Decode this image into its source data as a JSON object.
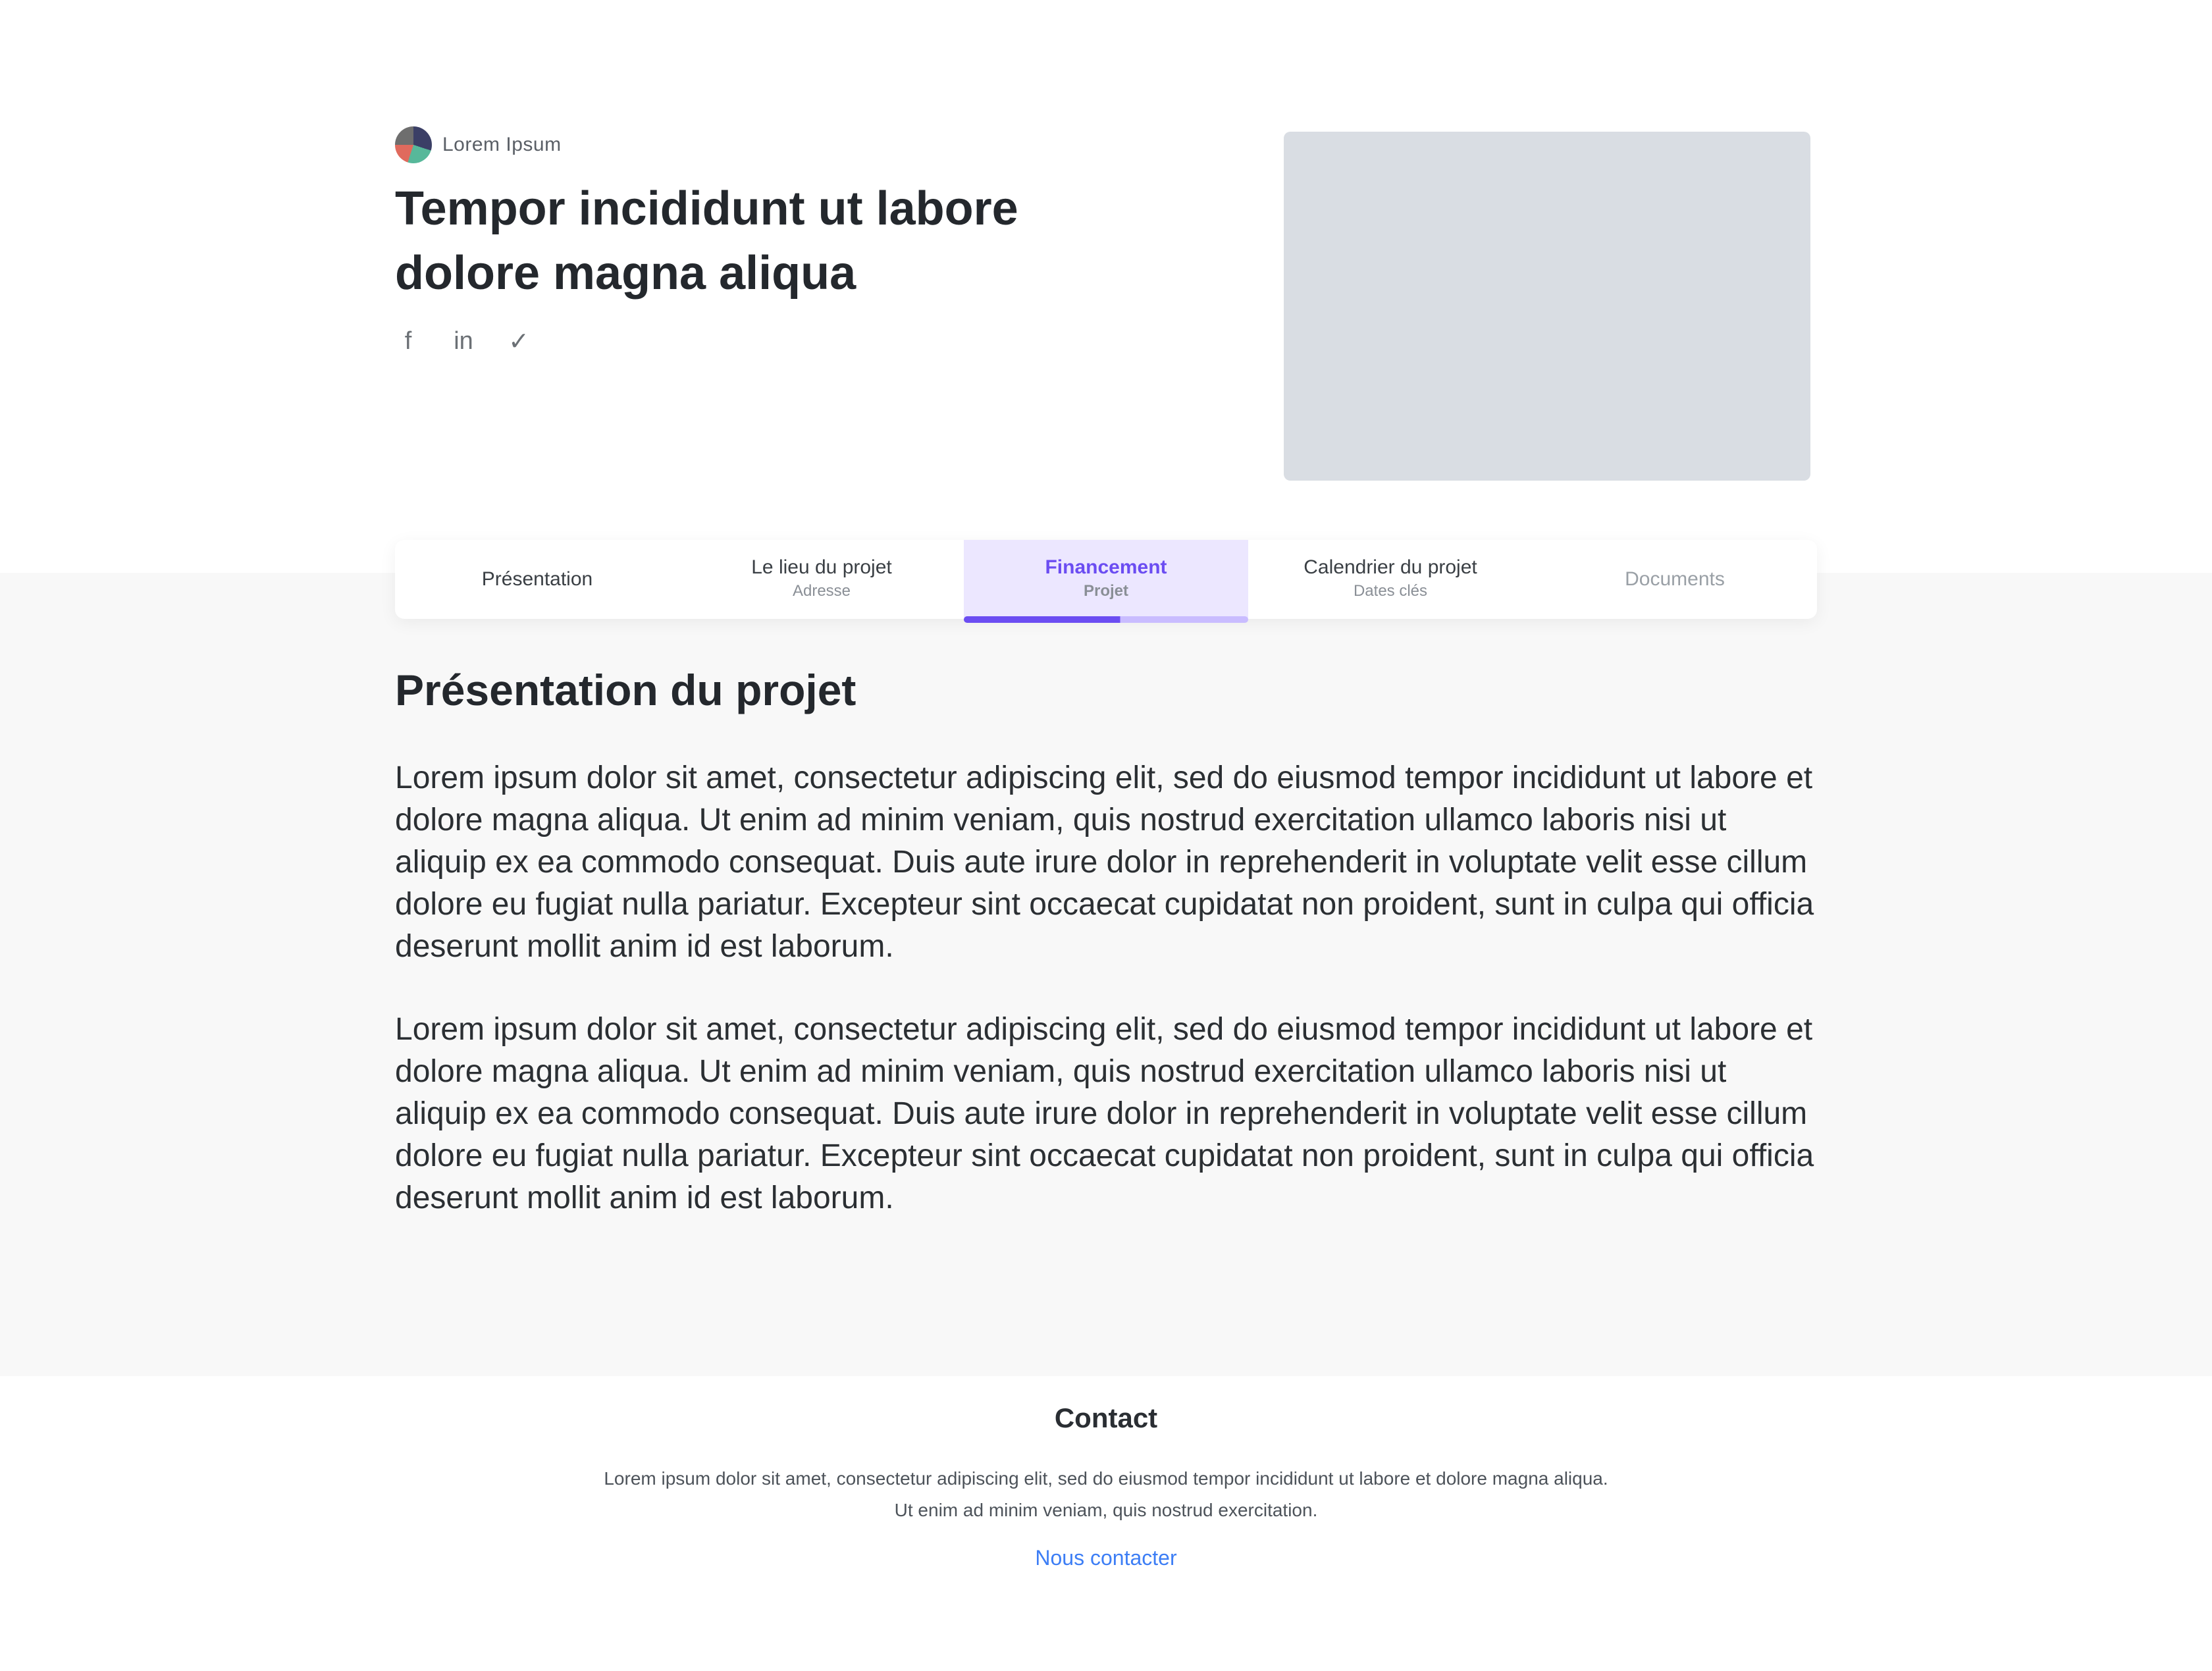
{
  "header": {
    "brand_name": "Lorem Ipsum",
    "title": "Tempor incididunt ut labore dolore magna aliqua",
    "social_icons": [
      "facebook-icon",
      "linkedin-icon",
      "twitter-icon"
    ]
  },
  "tabs": [
    {
      "label": "Présentation",
      "sub": ""
    },
    {
      "label": "Le lieu du projet",
      "sub": "Adresse"
    },
    {
      "label": "Financement",
      "sub": "Projet"
    },
    {
      "label": "Calendrier du projet",
      "sub": "Dates clés"
    },
    {
      "label": "Documents",
      "sub": ""
    }
  ],
  "content": {
    "section_title": "Présentation du projet",
    "paragraphs": [
      "Lorem ipsum dolor sit amet, consectetur adipiscing elit, sed do eiusmod tempor incididunt ut labore et dolore magna aliqua. Ut enim ad minim veniam, quis nostrud exercitation ullamco laboris nisi ut aliquip ex ea commodo consequat. Duis aute irure dolor in reprehenderit in voluptate velit esse cillum dolore eu fugiat nulla pariatur. Excepteur sint occaecat cupidatat non proident, sunt in culpa qui officia deserunt mollit anim id est laborum.",
      "Lorem ipsum dolor sit amet, consectetur adipiscing elit, sed do eiusmod tempor incididunt ut labore et dolore magna aliqua. Ut enim ad minim veniam, quis nostrud exercitation ullamco laboris nisi ut aliquip ex ea commodo consequat. Duis aute irure dolor in reprehenderit in voluptate velit esse cillum dolore eu fugiat nulla pariatur. Excepteur sint occaecat cupidatat non proident, sunt in culpa qui officia deserunt mollit anim id est laborum."
    ]
  },
  "footer": {
    "title": "Contact",
    "text": "Lorem ipsum dolor sit amet, consectetur adipiscing elit, sed do eiusmod tempor incididunt ut labore et dolore magna aliqua. Ut enim ad minim veniam, quis nostrud exercitation.",
    "link": "Nous contacter"
  }
}
